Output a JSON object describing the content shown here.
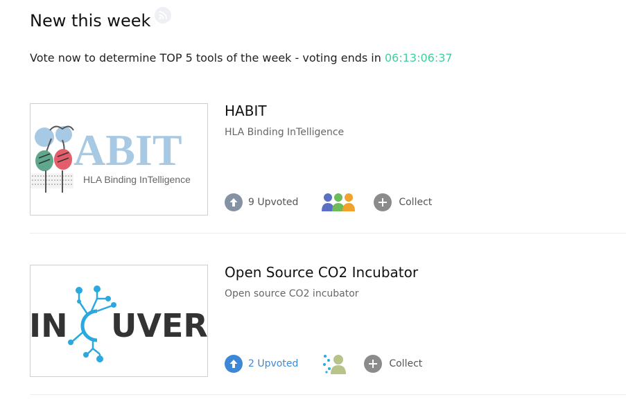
{
  "section": {
    "title": "New this week",
    "vote_prefix": "Vote now to determine TOP 5 tools of the week - voting ends in ",
    "countdown": "06:13:06:37"
  },
  "tools": [
    {
      "name": "HABIT",
      "description": "HLA Binding InTelligence",
      "logo_text": "ABIT",
      "logo_subtitle": "HLA Binding InTelligence",
      "upvote_label": "9 Upvoted",
      "upvoted": false,
      "collect_label": "Collect"
    },
    {
      "name": "Open Source CO2 Incubator",
      "description": "Open source CO2 incubator",
      "logo_text_left": "IN",
      "logo_text_right": "UVERS",
      "upvote_label": "2 Upvoted",
      "upvoted": true,
      "collect_label": "Collect"
    }
  ],
  "colors": {
    "countdown": "#3ecf9a",
    "upvote_active": "#3c87d6",
    "habit_logo": "#a7c9e3",
    "incuvers_accent": "#2ba8e0"
  }
}
